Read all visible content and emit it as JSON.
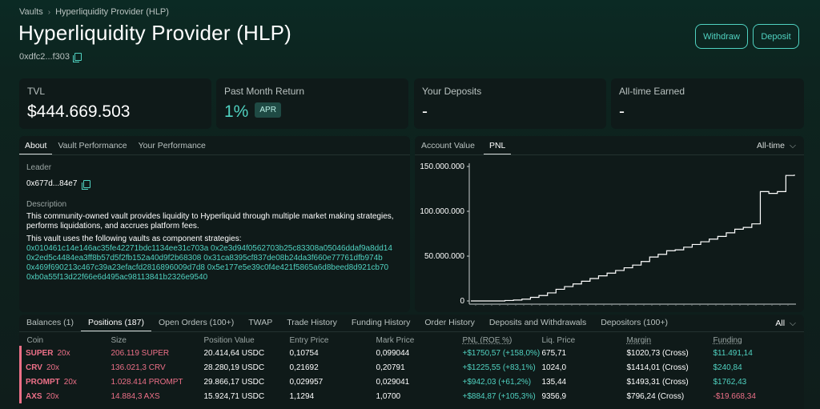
{
  "breadcrumb": {
    "root": "Vaults",
    "current": "Hyperliquidity Provider (HLP)"
  },
  "title": "Hyperliquidity Provider (HLP)",
  "address": "0xdfc2...f303",
  "buttons": {
    "withdraw": "Withdraw",
    "deposit": "Deposit"
  },
  "stats": {
    "tvl": {
      "label": "TVL",
      "value": "$444.669.503"
    },
    "month_return": {
      "label": "Past Month Return",
      "value": "1%",
      "badge": "APR"
    },
    "deposits": {
      "label": "Your Deposits",
      "value": "-"
    },
    "earned": {
      "label": "All-time Earned",
      "value": "-"
    }
  },
  "about": {
    "tabs": [
      "About",
      "Vault Performance",
      "Your Performance"
    ],
    "leader_label": "Leader",
    "leader": "0x677d...84e7",
    "description_label": "Description",
    "description": "This community-owned vault provides liquidity to Hyperliquid through multiple market making strategies, performs liquidations, and accrues platform fees.",
    "vaults_intro": "This vault uses the following vaults as component strategies:",
    "vaults": [
      "0x010461c14e146ac35fe42271bdc1134ee31c703a",
      "0x2e3d94f0562703b25c83308a05046ddaf9a8dd14",
      "0x2ed5c4484ea3ff8b57d5f2fb152a40d9f2b68308",
      "0x31ca8395cf837de08b24da3f660e77761dfb974b",
      "0x469f690213c467c39a23efacfd2816896009d7d8",
      "0x5e177e5e39c0f4e421f5865a6d8beed8d921cb70",
      "0xb0a55f13d22f66e6d495ac98113841b2326e9540"
    ]
  },
  "chart_tabs": [
    "Account Value",
    "PNL"
  ],
  "chart_range": "All-time",
  "chart_data": {
    "type": "line",
    "series": [
      {
        "name": "",
        "values": [
          0,
          0,
          0,
          0,
          500000,
          1000000,
          2000000,
          4000000,
          6000000,
          9000000,
          13000000,
          16000000,
          19000000,
          22000000,
          25000000,
          28000000,
          31000000,
          34000000,
          37000000,
          40000000,
          44000000,
          49000000,
          52000000,
          56000000,
          57000000,
          60000000,
          63000000,
          66000000,
          69000000,
          72000000,
          76000000,
          80000000,
          82000000,
          86000000,
          122000000,
          120000000,
          122000000,
          140000000,
          141000000
        ]
      }
    ],
    "ylim": [
      0,
      150000000
    ],
    "yticks": [
      "150.000.000",
      "100.000.000",
      "50.000.000",
      "0"
    ],
    "grid": false
  },
  "positions": {
    "tabs": [
      "Balances (1)",
      "Positions (187)",
      "Open Orders (100+)",
      "TWAP",
      "Trade History",
      "Funding History",
      "Order History",
      "Deposits and Withdrawals",
      "Depositors (100+)"
    ],
    "filter": "All",
    "headers": [
      "Coin",
      "Size",
      "Position Value",
      "Entry Price",
      "Mark Price",
      "PNL (ROE %)",
      "Liq. Price",
      "Margin",
      "Funding"
    ],
    "rows": [
      [
        "SUPER",
        "20x",
        "206.119 SUPER",
        "20.414,64 USDC",
        "0,10754",
        "0,099044",
        "+$1750,57 (+158,0%)",
        "675,71",
        "$1020,73 (Cross)",
        "$11.491,14"
      ],
      [
        "CRV",
        "20x",
        "136.021,3 CRV",
        "28.280,19 USDC",
        "0,21692",
        "0,20791",
        "+$1225,55 (+83,1%)",
        "1024,0",
        "$1414,01 (Cross)",
        "$240,84"
      ],
      [
        "PROMPT",
        "20x",
        "1.028.414 PROMPT",
        "29.866,17 USDC",
        "0,029957",
        "0,029041",
        "+$942,03 (+61,2%)",
        "135,44",
        "$1493,31 (Cross)",
        "$1762,43"
      ],
      [
        "AXS",
        "20x",
        "14.884,3 AXS",
        "15.924,71 USDC",
        "1,1294",
        "1,0700",
        "+$884,87 (+105,3%)",
        "9356,9",
        "$796,24 (Cross)",
        "-$19.668,34"
      ]
    ]
  }
}
